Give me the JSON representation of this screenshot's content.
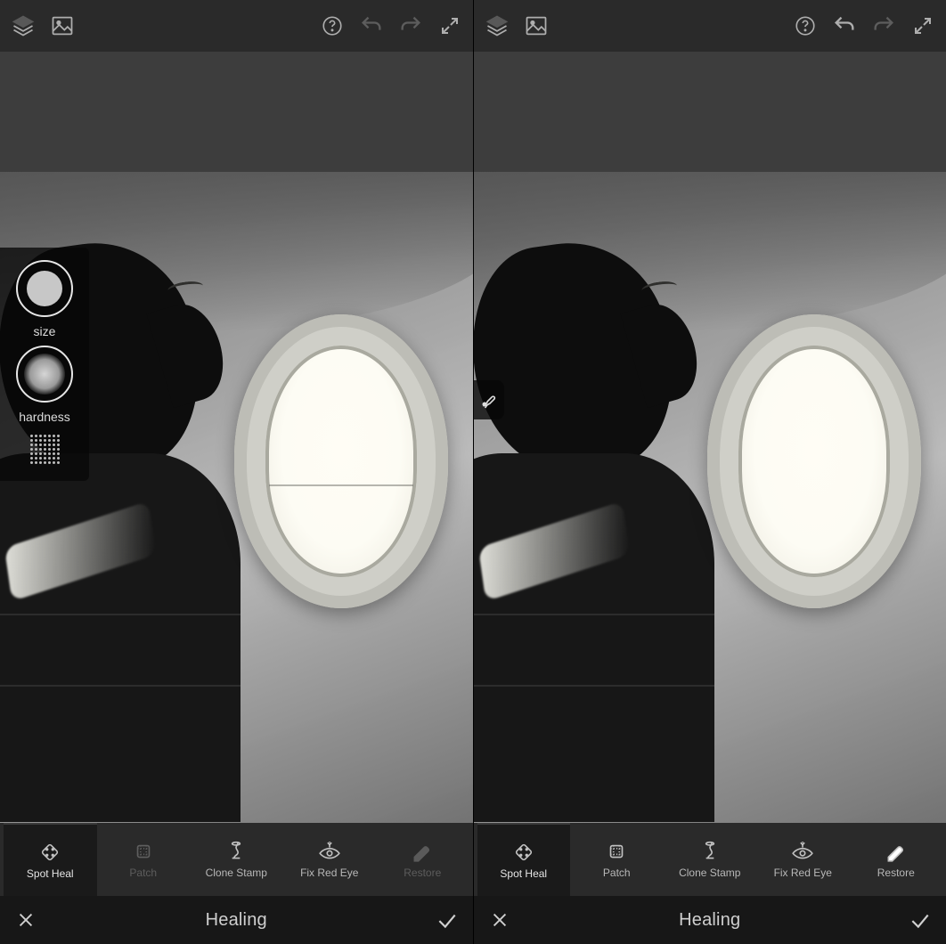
{
  "panels": [
    {
      "brush_panel": {
        "size_label": "size",
        "hardness_label": "hardness"
      },
      "tools": {
        "spot_heal": "Spot Heal",
        "patch": "Patch",
        "clone_stamp": "Clone Stamp",
        "fix_red_eye": "Fix Red Eye",
        "restore": "Restore"
      },
      "mode_title": "Healing",
      "selected_tool": "spot_heal",
      "patch_disabled": true,
      "restore_disabled": true
    },
    {
      "tools": {
        "spot_heal": "Spot Heal",
        "patch": "Patch",
        "clone_stamp": "Clone Stamp",
        "fix_red_eye": "Fix Red Eye",
        "restore": "Restore"
      },
      "mode_title": "Healing",
      "selected_tool": "spot_heal",
      "patch_disabled": false,
      "restore_disabled": false
    }
  ]
}
